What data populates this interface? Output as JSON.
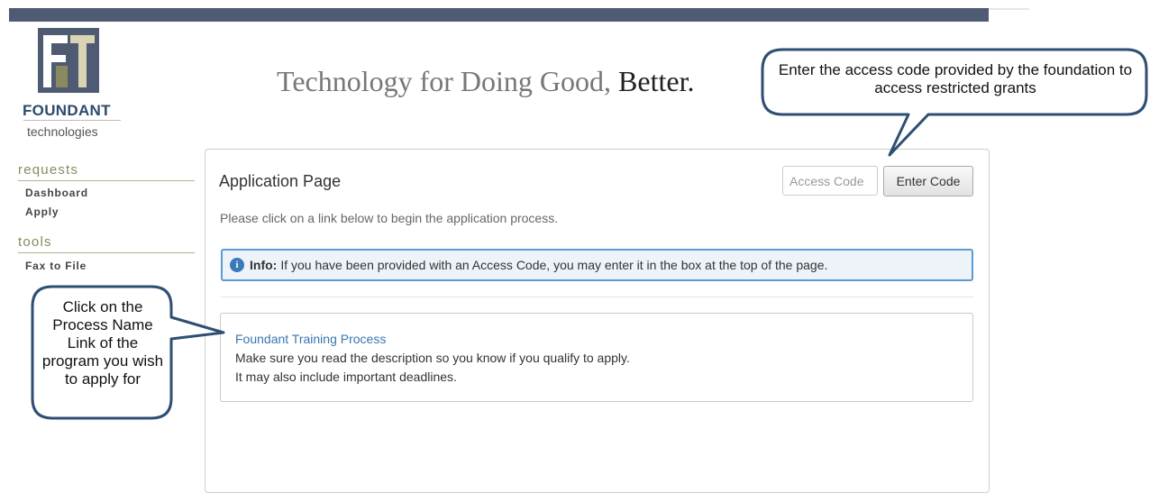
{
  "brand": {
    "name": "FOUNDANT",
    "subname": "technologies",
    "tagline_main": "Technology for Doing Good,",
    "tagline_strong": "Better.",
    "colors": {
      "navy": "#4f5b72",
      "olive": "#8a8a60",
      "link": "#3a75b0",
      "info_border": "#5b9bd5"
    }
  },
  "sidebar": {
    "sections": [
      {
        "heading": "requests",
        "items": [
          "Dashboard",
          "Apply"
        ]
      },
      {
        "heading": "tools",
        "items": [
          "Fax to File"
        ]
      }
    ]
  },
  "main": {
    "title": "Application Page",
    "access_code_placeholder": "Access Code",
    "enter_code_label": "Enter Code",
    "instructions": "Please click on a link below to begin the application process.",
    "info": {
      "icon": "info-circle-icon",
      "label": "Info:",
      "text": "If you have been provided with an Access Code, you may enter it in the box at the top of the page."
    },
    "process": {
      "name": "Foundant Training Process",
      "description_lines": [
        "Make sure you read the description so you know if you qualify to apply.",
        "It may also include important deadlines."
      ]
    }
  },
  "callouts": {
    "access_code": "Enter the access code provided by the foundation to access restricted grants",
    "process_link": "Click on the Process Name Link of the program you wish to apply for"
  }
}
